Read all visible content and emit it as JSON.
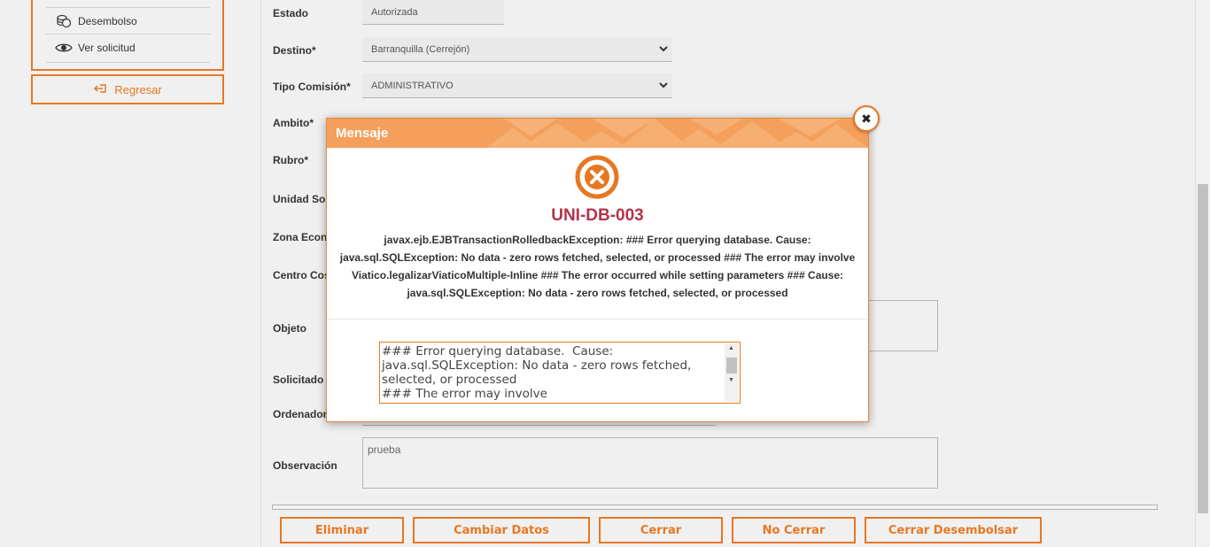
{
  "sidebar": {
    "items": [
      {
        "label": "Desembolso",
        "icon": "coins-icon"
      },
      {
        "label": "Ver solicitud",
        "icon": "eye-icon"
      }
    ],
    "back_button": "Regresar"
  },
  "form": {
    "estado": {
      "label": "Estado",
      "value": "Autorizada"
    },
    "destino": {
      "label": "Destino*",
      "value": "Barranquilla (Cerrejón)"
    },
    "tipo_comision": {
      "label": "Tipo Comisión*",
      "value": "ADMINISTRATIVO"
    },
    "ambito": {
      "label": "Ambito*"
    },
    "rubro": {
      "label": "Rubro*"
    },
    "unidad": {
      "label": "Unidad Soli"
    },
    "zona": {
      "label": "Zona Econc"
    },
    "centro": {
      "label": "Centro Cos"
    },
    "objeto": {
      "label": "Objeto"
    },
    "solicitado": {
      "label": "Solicitado"
    },
    "ordenador": {
      "label": "Ordenador"
    },
    "observacion": {
      "label": "Observación",
      "value": "prueba"
    }
  },
  "actions": {
    "eliminar": "Eliminar",
    "cambiar_datos": "Cambiar Datos",
    "cerrar": "Cerrar",
    "no_cerrar": "No Cerrar",
    "cerrar_desembolsar": "Cerrar Desembolsar"
  },
  "modal": {
    "title": "Mensaje",
    "close_glyph": "✖",
    "error_code": "UNI-DB-003",
    "message": "javax.ejb.EJBTransactionRolledbackException: ### Error querying database. Cause: java.sql.SQLException: No data - zero rows fetched, selected, or processed ### The error may involve Viatico.legalizarViaticoMultiple-Inline ### The error occurred while setting parameters ### Cause: java.sql.SQLException: No data - zero rows fetched, selected, or processed",
    "detail": "### Error querying database.  Cause: java.sql.SQLException: No data - zero rows fetched, selected, or processed\n### The error may involve Viatico.legalizarViaticoMultiple-Inline",
    "icon": "error-x-icon"
  },
  "colors": {
    "accent": "#e87722",
    "header": "#f4a05c",
    "error_code": "#b5334a"
  }
}
